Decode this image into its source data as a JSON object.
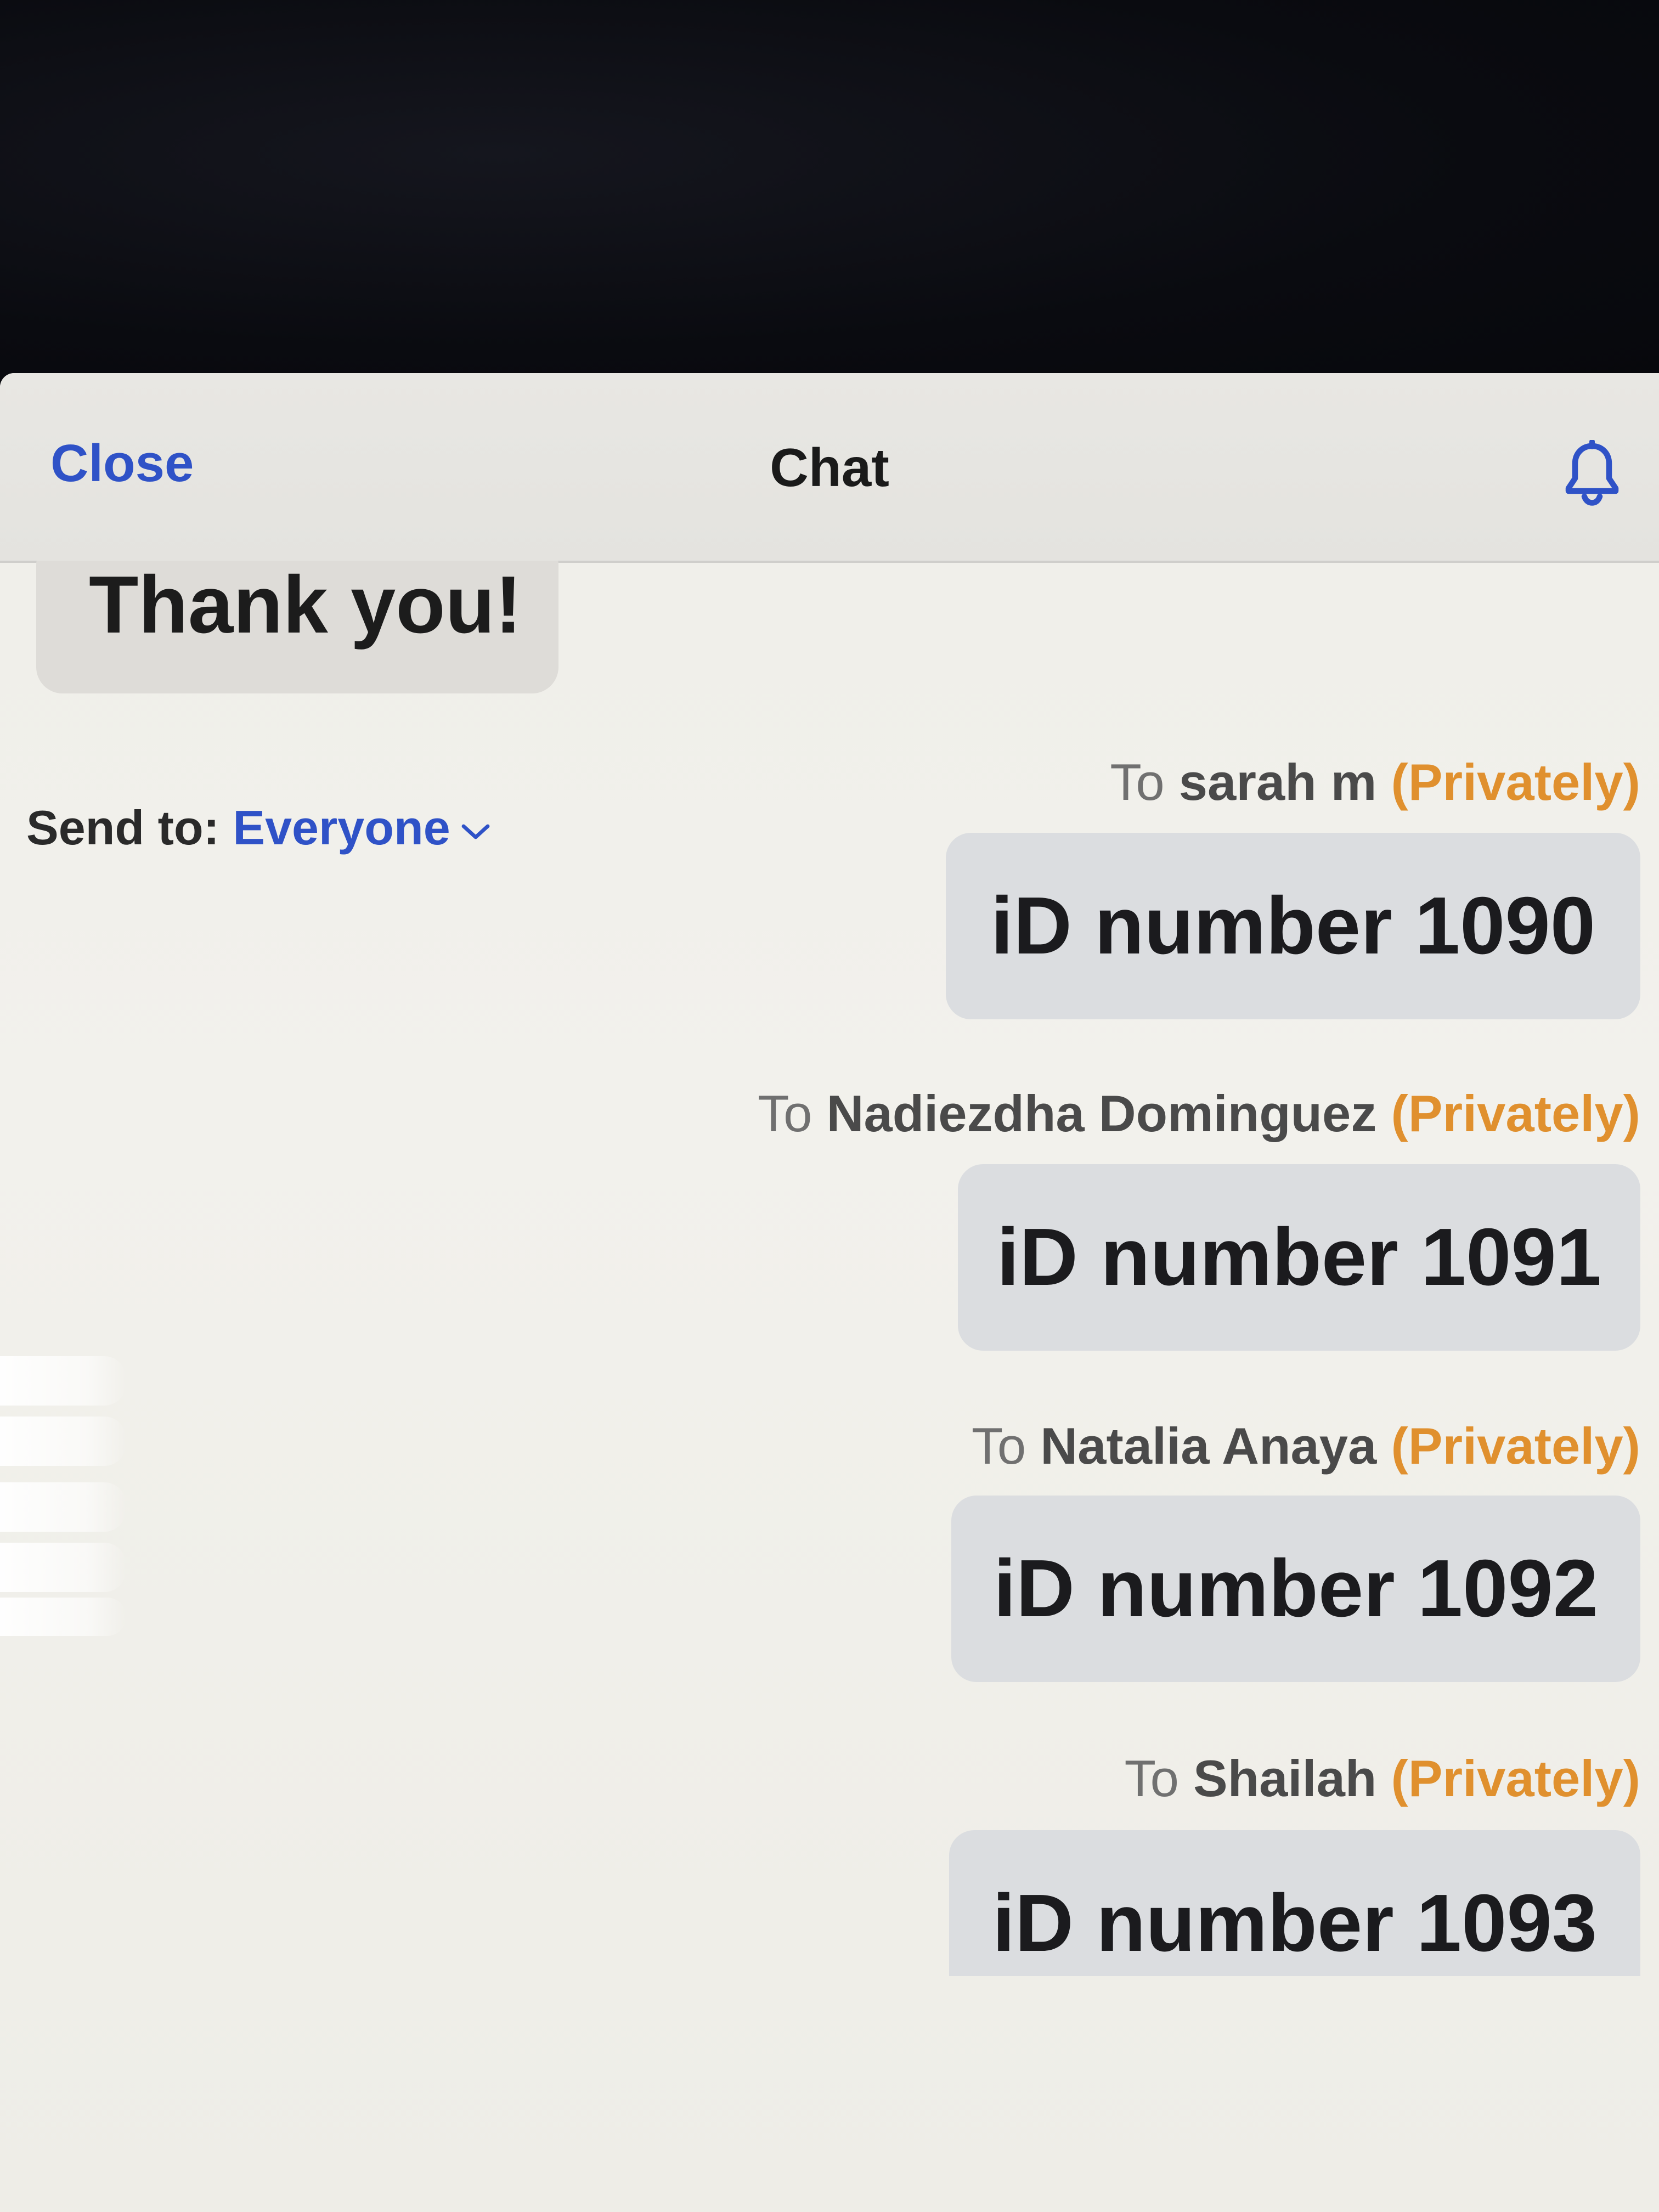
{
  "header": {
    "close_label": "Close",
    "title": "Chat",
    "bell_icon": "bell-icon"
  },
  "messages": [
    {
      "direction": "received",
      "text": "Thank you!"
    },
    {
      "direction": "sent",
      "to_prefix": "To",
      "recipient": "sarah m",
      "privacy": "(Privately)",
      "text": "iD number 1090"
    },
    {
      "direction": "sent",
      "to_prefix": "To",
      "recipient": "Nadiezdha Dominguez",
      "privacy": "(Privately)",
      "text": "iD number 1091"
    },
    {
      "direction": "sent",
      "to_prefix": "To",
      "recipient": "Natalia Anaya",
      "privacy": "(Privately)",
      "text": "iD number 1092"
    },
    {
      "direction": "sent",
      "to_prefix": "To",
      "recipient": "Shailah",
      "privacy": "(Privately)",
      "text": "iD number 1093"
    }
  ],
  "footer": {
    "send_to_label": "Send to:",
    "send_to_value": "Everyone",
    "dropdown_icon": "chevron-down-icon"
  },
  "colors": {
    "accent": "#2f52c7",
    "private": "#e0902e",
    "bubble": "#dbdde0"
  }
}
